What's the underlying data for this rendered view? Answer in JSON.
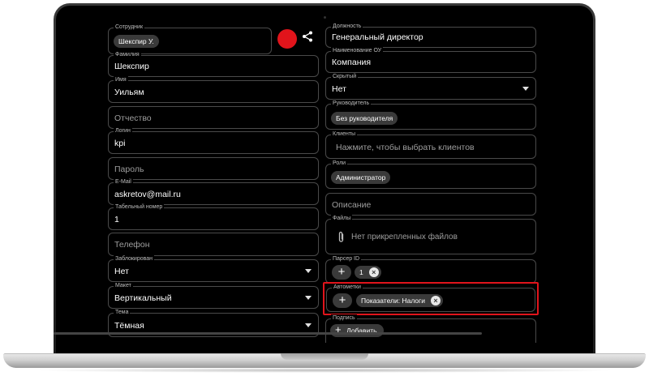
{
  "accent_color": "#e1141b",
  "left": {
    "employee": {
      "label": "Сотрудник",
      "chip": "Шекспир У."
    },
    "last_name": {
      "label": "Фамилия",
      "value": "Шекспир"
    },
    "first_name": {
      "label": "Имя",
      "value": "Уильям"
    },
    "patronymic": {
      "placeholder": "Отчество"
    },
    "login": {
      "label": "Логин",
      "value": "kpi"
    },
    "password": {
      "placeholder": "Пароль"
    },
    "email": {
      "label": "E-Mail",
      "value": "askretov@mail.ru"
    },
    "tab_number": {
      "label": "Табельный номер",
      "value": "1"
    },
    "phone": {
      "placeholder": "Телефон"
    },
    "blocked": {
      "label": "Заблокирован",
      "value": "Нет"
    },
    "layout": {
      "label": "Макет",
      "value": "Вертикальный"
    },
    "theme": {
      "label": "Тема",
      "value": "Тёмная"
    }
  },
  "right": {
    "position": {
      "label": "Должность",
      "value": "Генеральный директор"
    },
    "org_unit": {
      "label": "Наименование ОУ",
      "value": "Компания"
    },
    "hidden": {
      "label": "Скрытый",
      "value": "Нет"
    },
    "manager": {
      "label": "Руководитель",
      "chip": "Без руководителя"
    },
    "clients": {
      "label": "Клиенты",
      "placeholder": "Нажмите, чтобы выбрать клиентов"
    },
    "roles": {
      "label": "Роли",
      "chip": "Администратор"
    },
    "description": {
      "placeholder": "Описание"
    },
    "files": {
      "label": "Файлы",
      "empty_text": "Нет прикрепленных файлов",
      "icon": "paperclip-icon"
    },
    "parser_id": {
      "label": "Парсер ID",
      "chip": "1"
    },
    "auto_tags": {
      "label": "Автометки",
      "chip": "Показатели: Налоги"
    },
    "signature": {
      "label": "Подпись",
      "add_label": "Добавить"
    }
  },
  "icons": {
    "share": "share-icon",
    "add": "plus-icon",
    "remove": "close-icon"
  }
}
